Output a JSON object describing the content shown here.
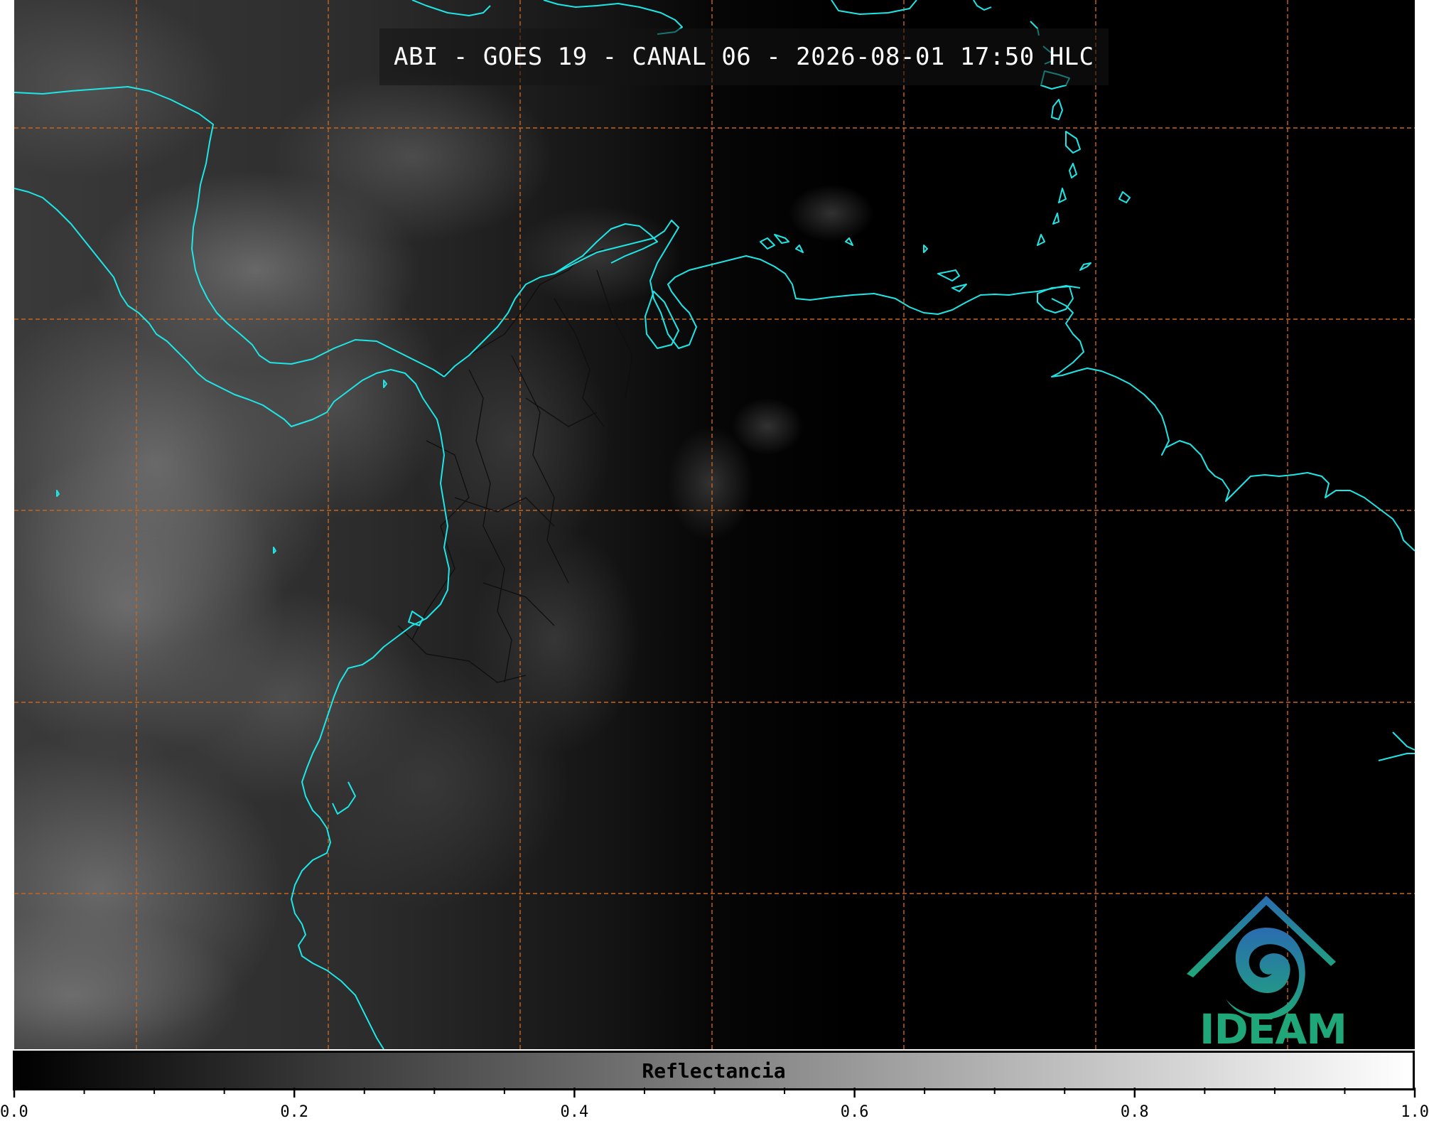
{
  "title": "ABI - GOES 19 - CANAL 06 - 2026-08-01 17:50 HLC",
  "colorbar": {
    "label": "Reflectancia",
    "ticks": [
      "0.0",
      "0.2",
      "0.4",
      "0.6",
      "0.8",
      "1.0"
    ],
    "range": [
      0.0,
      1.0
    ],
    "colormap": "grayscale"
  },
  "logo": {
    "text": "IDEAM",
    "icon": "ideam-hurricane-logo"
  },
  "colors": {
    "background": "#000000",
    "coastline": "#1ee6e6",
    "gridlines": "#c8651e",
    "admin_borders": "#111111",
    "logo_green": "#1fa77a",
    "logo_blue": "#2a6cb0"
  }
}
